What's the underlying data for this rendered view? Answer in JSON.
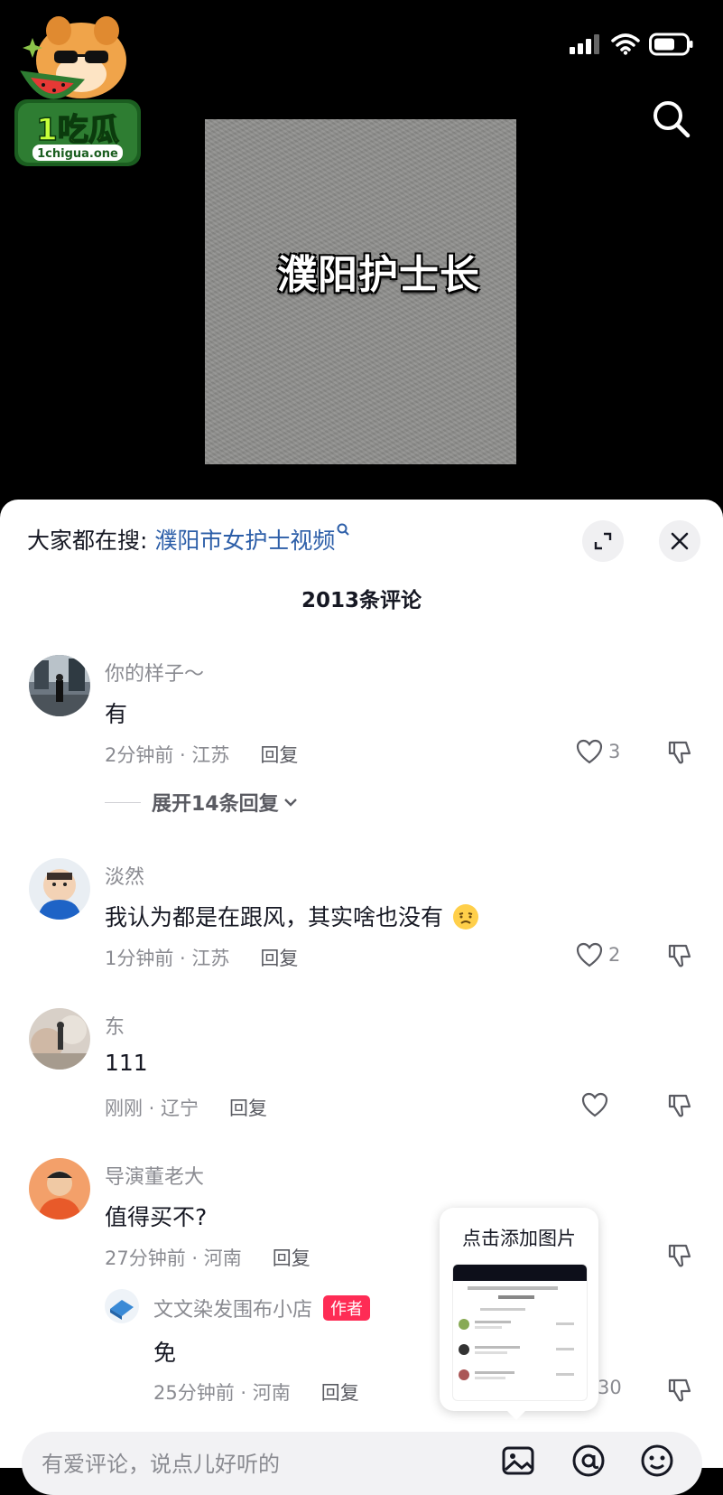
{
  "logo": {
    "text": "1吃瓜",
    "domain": "1chigua.one"
  },
  "video": {
    "overlay_title": "濮阳护士长"
  },
  "sheet": {
    "search_prefix": "大家都在搜:",
    "search_term": "濮阳市女护士视频",
    "comment_count": "2013条评论"
  },
  "comments": [
    {
      "name": "你的样子～",
      "text": "有",
      "time_loc": "2分钟前 · 江苏",
      "reply": "回复",
      "likes": "3",
      "expand": "展开14条回复"
    },
    {
      "name": "淡然",
      "text": "我认为都是在跟风，其实啥也没有",
      "time_loc": "1分钟前 · 江苏",
      "reply": "回复",
      "likes": "2"
    },
    {
      "name": "东",
      "text": "111",
      "time_loc": "刚刚 · 辽宁",
      "reply": "回复",
      "likes": ""
    },
    {
      "name": "导演董老大",
      "text": "值得买不?",
      "time_loc": "27分钟前 · 河南",
      "reply": "回复",
      "likes": ""
    }
  ],
  "sub_reply": {
    "name": "文文染发围布小店",
    "badge": "作者",
    "text": "免",
    "time_loc": "25分钟前 · 河南",
    "reply": "回复",
    "likes": "30"
  },
  "popup": {
    "title": "点击添加图片"
  },
  "input": {
    "placeholder": "有爱评论，说点儿好听的"
  },
  "colors": {
    "link": "#2c5ea8",
    "badge": "#fe2c55",
    "muted": "#8a8b91"
  }
}
